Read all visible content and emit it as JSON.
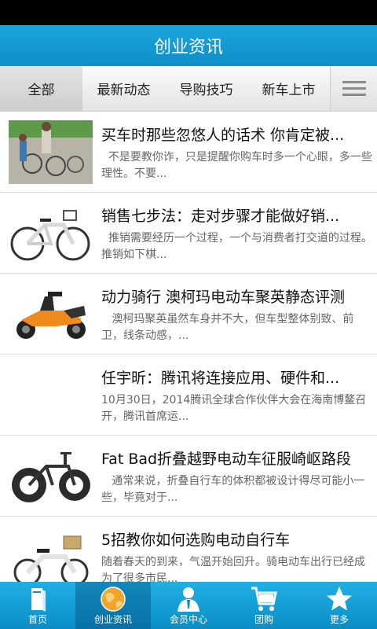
{
  "header": {
    "title": "创业资讯"
  },
  "tabs": [
    {
      "label": "全部",
      "active": true
    },
    {
      "label": "最新动态",
      "active": false
    },
    {
      "label": "导购技巧",
      "active": false
    },
    {
      "label": "新车上市",
      "active": false
    }
  ],
  "articles": [
    {
      "title": "买车时那些忽悠人的话术 你肯定被...",
      "summary": "  不是要教你诈，只是提醒你购车时多一个心眼，多一些理性。不要...",
      "thumb": "shop-photo"
    },
    {
      "title": "销售七步法：走对步骤才能做好销...",
      "summary": "  推销需要经历一个过程，一个与消费者打交道的过程。推销如下棋...",
      "thumb": "white-ebike"
    },
    {
      "title": "动力骑行 澳柯玛电动车聚英静态评测",
      "summary": "   澳柯玛聚英虽然车身并不大，但车型整体别致、前卫，线条动感，...",
      "thumb": "orange-scooter"
    },
    {
      "title": "任宇昕：腾讯将连接应用、硬件和...",
      "summary": "10月30日，2014腾讯全球合作伙伴大会在海南博鳌召开，腾讯首席运...",
      "thumb": "blank"
    },
    {
      "title": "Fat Bad折叠越野电动车征服崎岖路段",
      "summary": "   通常来说，折叠自行车的体积都被设计得尽可能小一些，毕竟对于...",
      "thumb": "fat-bike"
    },
    {
      "title": "5招教你如何选购电动自行车",
      "summary": "随着春天的到来，气温开始回升。骑电动车出行已经成为了很多市民...",
      "thumb": "white-ebike-basket"
    }
  ],
  "nav": [
    {
      "label": "首页",
      "icon": "book-icon",
      "active": false
    },
    {
      "label": "创业资讯",
      "icon": "globe-icon",
      "active": true
    },
    {
      "label": "会员中心",
      "icon": "user-icon",
      "active": false
    },
    {
      "label": "团购",
      "icon": "cart-icon",
      "active": false
    },
    {
      "label": "更多",
      "icon": "star-icon",
      "active": false
    }
  ],
  "colors": {
    "primary": "#1aa6dc",
    "nav": "#0b8dc6",
    "orange": "#f08a1c"
  }
}
